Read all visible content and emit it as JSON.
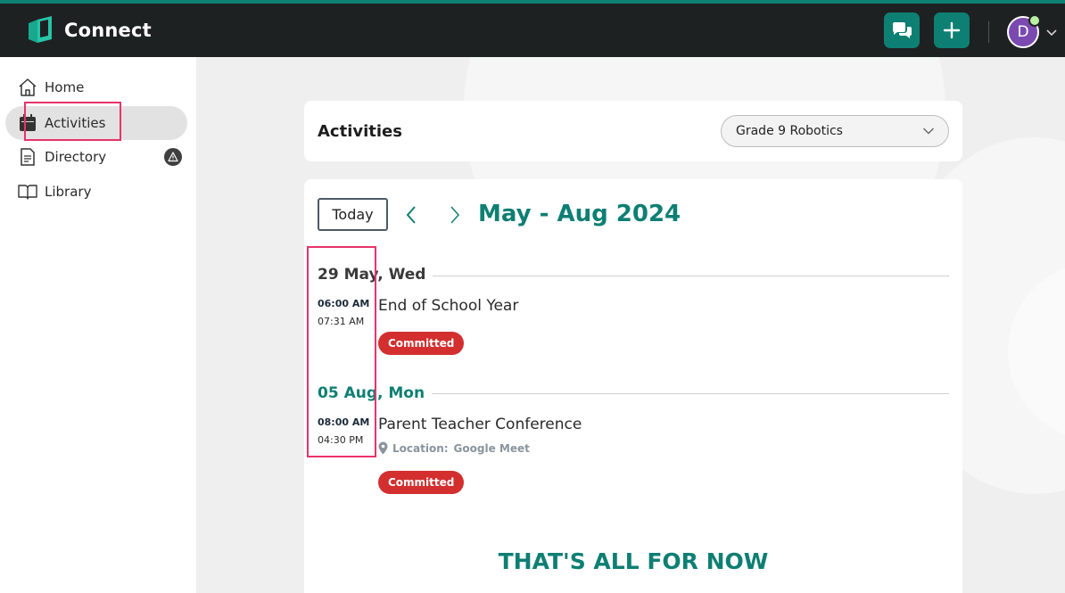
{
  "app": {
    "name": "Connect",
    "user_initial": "D"
  },
  "colors": {
    "brand": "#0e7f73",
    "topbar": "#1e2122",
    "status_committed": "#d32f2f",
    "highlight": "#e8336b",
    "avatar": "#7a4ab0"
  },
  "topbar": {
    "chat_icon": "chat-bubbles-icon",
    "add_icon": "plus-icon",
    "menu_icon": "chevron-down-icon"
  },
  "sidebar": {
    "items": [
      {
        "label": "Home",
        "icon": "home-icon",
        "active": false
      },
      {
        "label": "Activities",
        "icon": "calendar-icon",
        "active": true
      },
      {
        "label": "Directory",
        "icon": "document-icon",
        "active": false,
        "badge_icon": "warning-icon"
      },
      {
        "label": "Library",
        "icon": "book-icon",
        "active": false
      }
    ]
  },
  "header": {
    "title": "Activities",
    "group_selected": "Grade 9 Robotics"
  },
  "calendar": {
    "today_label": "Today",
    "range": "May - Aug 2024",
    "days": [
      {
        "label": "29 May, Wed",
        "color": "#3a3a3a",
        "events": [
          {
            "start": "06:00 AM",
            "end": "07:31 AM",
            "title": "End of School Year",
            "status": "Committed"
          }
        ]
      },
      {
        "label": "05 Aug, Mon",
        "color": "#0e7f73",
        "events": [
          {
            "start": "08:00 AM",
            "end": "04:30 PM",
            "title": "Parent Teacher Conference",
            "location_label": "Location:",
            "location": "Google Meet",
            "status": "Committed"
          }
        ]
      }
    ],
    "end_message": "THAT'S ALL FOR NOW"
  }
}
